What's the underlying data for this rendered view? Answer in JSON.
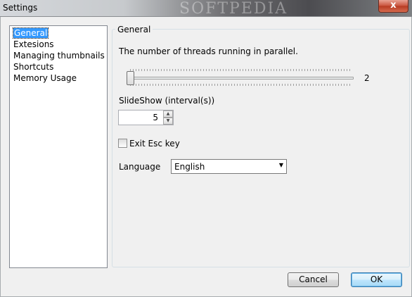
{
  "window": {
    "title": "Settings",
    "close_label": "x",
    "watermark": "SOFTPEDIA"
  },
  "nav": {
    "items": [
      {
        "label": "General",
        "selected": true
      },
      {
        "label": "Extesions",
        "selected": false
      },
      {
        "label": "Managing thumbnails",
        "selected": false
      },
      {
        "label": "Shortcuts",
        "selected": false
      },
      {
        "label": "Memory Usage",
        "selected": false
      }
    ]
  },
  "general": {
    "group_title": "General",
    "threads_label": "The number of threads running in parallel.",
    "threads_value": "2",
    "threads_slider_fraction": 0.0,
    "slideshow_label": "SlideShow (interval(s))",
    "slideshow_value": "5",
    "exit_esc_label": "Exit Esc key",
    "exit_esc_checked": false,
    "language_label": "Language",
    "language_value": "English"
  },
  "buttons": {
    "cancel": "Cancel",
    "ok": "OK"
  },
  "colors": {
    "selection": "#3399ff",
    "ok_border": "#3c7fb1"
  }
}
